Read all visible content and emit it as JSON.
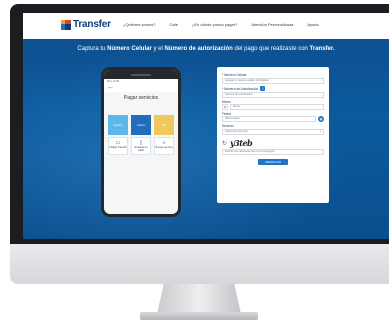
{
  "nav": {
    "logo_text": "Transfer",
    "links": [
      "¿Quiénes somos?",
      "Café",
      "¿En dónde puedo pagar?",
      "Atención Personalizada",
      "Ayuda"
    ]
  },
  "headline": {
    "prefix": "Captura tu ",
    "bold1": "Número Celular",
    "mid": " y el ",
    "bold2": "Número de autorización",
    "suffix": " del pago que realizaste con ",
    "bold3": "Transfer."
  },
  "phone": {
    "status": "Mov. 12:30",
    "back": "←",
    "title": "Pagar servicios",
    "tiles": [
      {
        "label": "Opción",
        "color": "#5fb6e8"
      },
      {
        "label": "Activo",
        "color": "#1f6fba"
      },
      {
        "label": "Ver",
        "color": "#f1c85b"
      }
    ],
    "tiles2": [
      {
        "icon": "▭",
        "label": "Código Transfer"
      },
      {
        "icon": "▯",
        "label": "Recarga de saldo"
      },
      {
        "icon": "⌕",
        "label": "Buscar servicio"
      }
    ]
  },
  "form": {
    "celular_label": "* Número Celular",
    "celular_placeholder": "Agregar tu número celular (10 dígitos)",
    "autorizacion_label": "* Número de Autorización",
    "autorizacion_placeholder": "Número de autorización",
    "monto_label": "Monto",
    "monto_currency": "$",
    "monto_placeholder": "Monto",
    "fecha_label": "Fecha",
    "fecha_placeholder": "dd/mm/aaaa",
    "servicio_label": "Servicio",
    "servicio_placeholder": "Selecciona Servicio",
    "captcha_text": "y3teb",
    "captcha_placeholder": "Escribe los caracteres que ve en la imagen",
    "submit_label": "VERIFICAR"
  },
  "colors": {
    "accent": "#1f72c6",
    "brand_navy": "#0c3e74",
    "background_blue": "#0b5a9e"
  }
}
